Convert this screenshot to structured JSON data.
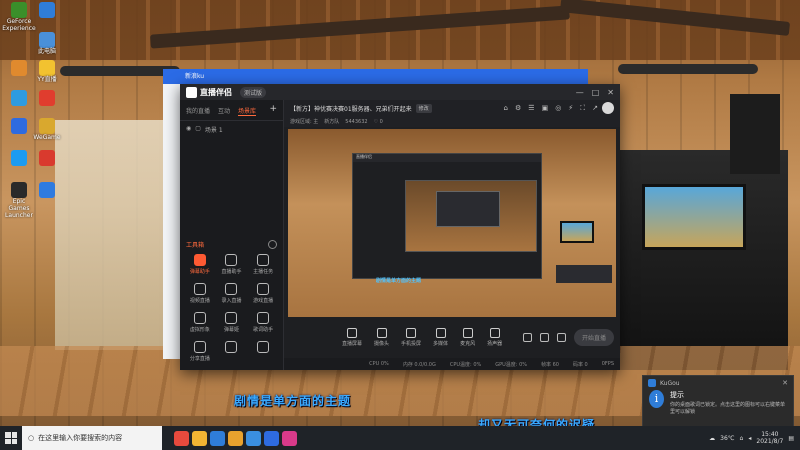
{
  "desktop": {
    "icons": [
      {
        "label": "GeForce Experience",
        "color": "#3a8f2a"
      },
      {
        "label": "",
        "color": "#2f7dd8"
      },
      {
        "label": "此电脑",
        "color": "#4a90d9"
      },
      {
        "label": "",
        "color": "#e08a2e"
      },
      {
        "label": "YY直播",
        "color": "#f2c230"
      },
      {
        "label": "",
        "color": "#2e9be0"
      },
      {
        "label": "",
        "color": "#e03d2e"
      },
      {
        "label": "",
        "color": "#2e6be0"
      },
      {
        "label": "WeGame",
        "color": "#d9a82e"
      },
      {
        "label": "",
        "color": "#1d9bf0"
      },
      {
        "label": "",
        "color": "#d93a2e"
      },
      {
        "label": "Epic Games Launcher",
        "color": "#2a2a2a"
      },
      {
        "label": "",
        "color": "#2e7be0"
      }
    ]
  },
  "taskbar": {
    "search_placeholder": "在这里输入你要搜索的内容",
    "apps": [
      "#e84a3d",
      "#f2b533",
      "#2f7dd8",
      "#e8a22e",
      "#3a8fe0",
      "#2e6be0",
      "#d93a8a"
    ],
    "temp": "36℃",
    "clock_time": "15:40",
    "clock_date": "2021/8/7"
  },
  "bg_window": {
    "title": "新浪ku"
  },
  "app": {
    "brand": "直播伴侣",
    "version": "测试版",
    "title_controls": [
      "—",
      "□",
      "✕"
    ],
    "sidebar": {
      "tabs": [
        "我的直播",
        "互动",
        "场景库"
      ],
      "active_tab": "场景库",
      "scene_label": "场景 1",
      "tools_label": "工具箱",
      "tools": [
        {
          "label": "弹幕助手",
          "hot": true
        },
        {
          "label": "直播助手",
          "hot": false
        },
        {
          "label": "主播任务",
          "hot": false
        },
        {
          "label": "视频直播",
          "hot": false
        },
        {
          "label": "录入直播",
          "hot": false
        },
        {
          "label": "游戏直播",
          "hot": false
        },
        {
          "label": "虚拟形象",
          "hot": false
        },
        {
          "label": "弹幕姬",
          "hot": false
        },
        {
          "label": "歌词助手",
          "hot": false
        },
        {
          "label": "分享直播",
          "hot": false
        },
        {
          "label": "",
          "hot": false
        },
        {
          "label": "",
          "hot": false
        }
      ]
    },
    "room": {
      "title": "【新方】神优赛决赛01服务器、兄弟们开起来",
      "tag": "修改",
      "sub": [
        "游戏区域: 主",
        "新方队",
        "5443632",
        "♡ 0"
      ],
      "icons": [
        "⌂",
        "⚙",
        "☰",
        "▣",
        "◎",
        "⚡",
        "⛶",
        "↗"
      ]
    },
    "preview": {
      "inner_title": "直播伴侣",
      "caption": "剧情是单方面的主题"
    },
    "bottom": {
      "items": [
        "直播屏幕",
        "摄像头",
        "手机投屏",
        "多媒体",
        "麦克风",
        "扬声器"
      ],
      "start_label": "开始直播"
    },
    "status": [
      "CPU 0%",
      "内存 0.0/0.0G",
      "CPU温度: 0%",
      "GPU温度: 0%",
      "帧率 60",
      "码率 0",
      "0FPS"
    ]
  },
  "subtitles": {
    "line1": "剧情是单方面的主题",
    "line2": "却又无可奈何的迟疑"
  },
  "toast": {
    "app": "KuGou",
    "title": "提示",
    "body": "你的桌面歌词已锁定。点击这里的图标可以右键菜单里可以解锁"
  }
}
